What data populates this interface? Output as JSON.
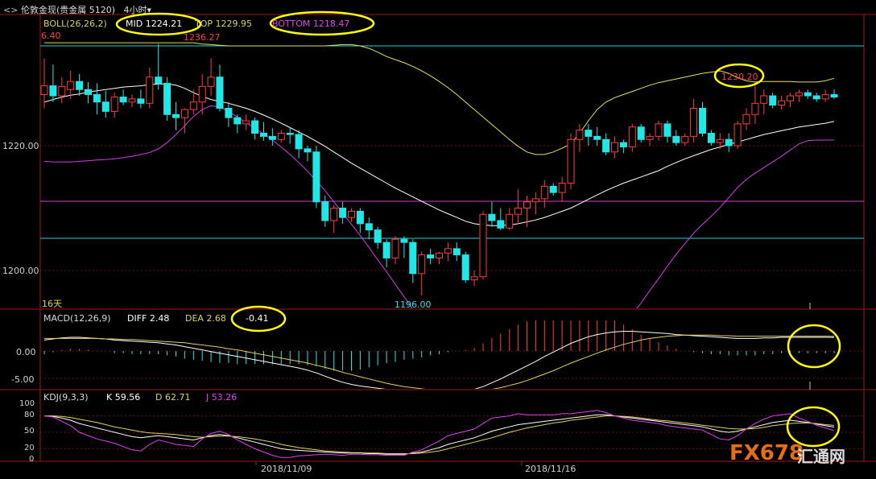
{
  "titlebar": {
    "icon": "back-arrows-icon",
    "symbol": "伦敦金现",
    "group": "(贵金属",
    "code": "5120)",
    "period": "4小时",
    "period_caret": "▼"
  },
  "boll": {
    "label": "BOLL(26,26,2)",
    "mid": "MID 1224.21",
    "top": "TOP 1229.95",
    "bottom": "BOTTOM 1218.47",
    "colors": {
      "mid": "#ffffff",
      "top": "#e8e05a",
      "bottom": "#d23be6"
    }
  },
  "price_axis": {
    "ticks": [
      "1220.00",
      "1200.00"
    ]
  },
  "price_labels": {
    "left_high": "6.40",
    "high": "1236.27",
    "recent_high": "1230.20",
    "low": "1196.00",
    "period_count": "16天"
  },
  "macd": {
    "label": "MACD(12,26,9)",
    "diff": "DIFF 2.48",
    "dea": "DEA 2.68",
    "macd_value": "-0.41",
    "axis": [
      "0.00",
      "-5.00"
    ]
  },
  "kdj": {
    "label": "KDJ(9,3,3)",
    "k": "K 59.56",
    "d": "D 62.71",
    "j": "J 53.26",
    "axis": [
      "100",
      "80",
      "50",
      "20",
      "0"
    ]
  },
  "dates": [
    "2018/11/09",
    "2018/11/16"
  ],
  "watermark": {
    "brand": "FX678",
    "cn": "汇通网"
  },
  "colors": {
    "up": "#ff3b3b",
    "down": "#22e6e6",
    "grid": "#8a1a1a",
    "highlight": "#ffff00"
  },
  "chart_data": [
    {
      "type": "candlestick",
      "title": "",
      "ohlc": [
        [
          1228.2,
          1234.0,
          1226.0,
          1229.6
        ],
        [
          1229.6,
          1233.0,
          1227.0,
          1228.0
        ],
        [
          1228.0,
          1231.0,
          1226.8,
          1229.5
        ],
        [
          1229.0,
          1232.0,
          1227.5,
          1230.3
        ],
        [
          1230.3,
          1231.5,
          1228.0,
          1229.0
        ],
        [
          1229.0,
          1230.2,
          1226.8,
          1228.2
        ],
        [
          1228.2,
          1230.0,
          1225.0,
          1227.0
        ],
        [
          1227.0,
          1228.8,
          1224.5,
          1225.5
        ],
        [
          1225.5,
          1228.5,
          1224.5,
          1227.8
        ],
        [
          1227.8,
          1229.0,
          1226.5,
          1227.0
        ],
        [
          1227.0,
          1228.2,
          1226.2,
          1227.5
        ],
        [
          1227.5,
          1229.0,
          1226.0,
          1226.8
        ],
        [
          1226.8,
          1232.5,
          1226.0,
          1231.0
        ],
        [
          1231.0,
          1236.3,
          1229.0,
          1230.0
        ],
        [
          1230.0,
          1231.0,
          1224.0,
          1225.0
        ],
        [
          1225.0,
          1227.0,
          1222.5,
          1224.5
        ],
        [
          1224.5,
          1226.0,
          1222.0,
          1225.8
        ],
        [
          1225.8,
          1229.0,
          1225.0,
          1227.0
        ],
        [
          1227.0,
          1231.5,
          1225.0,
          1229.5
        ],
        [
          1229.5,
          1234.0,
          1228.0,
          1231.0
        ],
        [
          1231.0,
          1233.0,
          1225.5,
          1226.0
        ],
        [
          1226.0,
          1227.0,
          1223.0,
          1224.5
        ],
        [
          1224.5,
          1225.0,
          1222.0,
          1223.5
        ],
        [
          1223.5,
          1225.0,
          1222.5,
          1224.0
        ],
        [
          1224.0,
          1224.5,
          1221.0,
          1222.0
        ],
        [
          1222.0,
          1223.8,
          1220.8,
          1221.5
        ],
        [
          1221.5,
          1222.8,
          1220.0,
          1221.0
        ],
        [
          1221.0,
          1222.5,
          1220.5,
          1222.0
        ],
        [
          1222.0,
          1223.0,
          1220.3,
          1221.8
        ],
        [
          1221.8,
          1222.5,
          1218.0,
          1219.5
        ],
        [
          1219.5,
          1220.0,
          1217.5,
          1219.0
        ],
        [
          1219.0,
          1220.0,
          1210.0,
          1211.0
        ],
        [
          1211.0,
          1212.0,
          1207.0,
          1208.0
        ],
        [
          1208.0,
          1210.5,
          1206.0,
          1210.0
        ],
        [
          1210.0,
          1211.0,
          1207.5,
          1208.5
        ],
        [
          1208.5,
          1210.0,
          1207.8,
          1209.5
        ],
        [
          1209.5,
          1210.0,
          1206.0,
          1207.5
        ],
        [
          1207.5,
          1208.5,
          1205.0,
          1206.5
        ],
        [
          1206.5,
          1207.0,
          1203.5,
          1204.5
        ],
        [
          1204.5,
          1205.0,
          1200.5,
          1202.0
        ],
        [
          1202.0,
          1205.5,
          1201.0,
          1205.0
        ],
        [
          1205.0,
          1205.5,
          1202.0,
          1204.5
        ],
        [
          1204.5,
          1205.0,
          1198.0,
          1199.5
        ],
        [
          1199.5,
          1203.0,
          1196.0,
          1202.5
        ],
        [
          1202.5,
          1203.5,
          1201.0,
          1202.0
        ],
        [
          1202.0,
          1203.0,
          1201.0,
          1202.8
        ],
        [
          1202.8,
          1204.5,
          1201.5,
          1203.5
        ],
        [
          1203.5,
          1204.5,
          1201.5,
          1202.5
        ],
        [
          1202.5,
          1203.0,
          1198.0,
          1198.5
        ],
        [
          1198.5,
          1200.0,
          1197.5,
          1199.0
        ],
        [
          1199.0,
          1209.5,
          1198.5,
          1209.0
        ],
        [
          1209.0,
          1211.0,
          1207.0,
          1208.0
        ],
        [
          1208.0,
          1210.0,
          1206.5,
          1206.8
        ],
        [
          1206.8,
          1210.0,
          1206.5,
          1209.0
        ],
        [
          1209.0,
          1213.0,
          1207.5,
          1210.0
        ],
        [
          1210.0,
          1212.0,
          1207.0,
          1211.0
        ],
        [
          1211.0,
          1212.5,
          1209.0,
          1211.5
        ],
        [
          1211.5,
          1214.5,
          1210.0,
          1213.5
        ],
        [
          1213.5,
          1214.0,
          1212.0,
          1212.5
        ],
        [
          1212.5,
          1215.0,
          1211.0,
          1214.0
        ],
        [
          1214.0,
          1222.0,
          1213.0,
          1221.0
        ],
        [
          1221.0,
          1223.5,
          1219.0,
          1222.5
        ],
        [
          1222.5,
          1223.5,
          1220.0,
          1221.5
        ],
        [
          1221.5,
          1223.0,
          1220.0,
          1221.0
        ],
        [
          1221.0,
          1222.0,
          1218.5,
          1219.0
        ],
        [
          1219.0,
          1221.5,
          1218.0,
          1220.5
        ],
        [
          1220.5,
          1221.0,
          1218.8,
          1219.8
        ],
        [
          1219.8,
          1223.5,
          1219.0,
          1223.0
        ],
        [
          1223.0,
          1223.5,
          1220.5,
          1221.0
        ],
        [
          1221.0,
          1222.0,
          1220.0,
          1221.5
        ],
        [
          1221.5,
          1224.0,
          1220.8,
          1223.5
        ],
        [
          1223.5,
          1224.0,
          1220.5,
          1221.5
        ],
        [
          1221.5,
          1222.5,
          1220.0,
          1220.5
        ],
        [
          1220.5,
          1222.0,
          1220.0,
          1221.5
        ],
        [
          1221.5,
          1227.5,
          1220.5,
          1226.0
        ],
        [
          1226.0,
          1227.0,
          1221.5,
          1222.0
        ],
        [
          1222.0,
          1222.5,
          1220.0,
          1220.5
        ],
        [
          1220.5,
          1222.0,
          1219.5,
          1221.0
        ],
        [
          1221.0,
          1222.0,
          1219.0,
          1220.0
        ],
        [
          1220.0,
          1224.0,
          1219.5,
          1223.5
        ],
        [
          1223.5,
          1226.0,
          1222.5,
          1225.0
        ],
        [
          1225.0,
          1230.2,
          1223.5,
          1226.8
        ],
        [
          1226.8,
          1229.0,
          1225.0,
          1228.0
        ],
        [
          1228.0,
          1228.5,
          1226.0,
          1226.5
        ],
        [
          1226.5,
          1228.0,
          1225.8,
          1227.2
        ],
        [
          1227.2,
          1228.5,
          1226.2,
          1228.0
        ],
        [
          1228.0,
          1229.0,
          1227.0,
          1228.5
        ],
        [
          1228.5,
          1229.0,
          1227.5,
          1228.0
        ],
        [
          1228.0,
          1228.5,
          1227.0,
          1227.5
        ],
        [
          1227.5,
          1229.0,
          1227.0,
          1228.2
        ],
        [
          1228.2,
          1229.0,
          1227.5,
          1227.8
        ]
      ],
      "boll_mid": [
        1227.0,
        1227.4,
        1227.8,
        1228.1,
        1228.3,
        1228.6,
        1228.8,
        1229.0,
        1229.2,
        1229.4,
        1229.5,
        1229.6,
        1229.8,
        1229.9,
        1229.9,
        1229.7,
        1229.2,
        1228.5,
        1227.9,
        1227.4,
        1227.1,
        1226.8,
        1226.4,
        1226.0,
        1225.5,
        1224.9,
        1224.3,
        1223.6,
        1222.9,
        1222.2,
        1221.5,
        1220.7,
        1219.9,
        1219.0,
        1218.1,
        1217.2,
        1216.4,
        1215.6,
        1214.8,
        1214.0,
        1213.2,
        1212.5,
        1211.8,
        1211.1,
        1210.4,
        1209.7,
        1209.1,
        1208.5,
        1207.9,
        1207.5,
        1207.3,
        1207.2,
        1207.2,
        1207.3,
        1207.5,
        1207.8,
        1208.1,
        1208.5,
        1209.0,
        1209.5,
        1210.0,
        1210.7,
        1211.4,
        1212.1,
        1212.8,
        1213.4,
        1214.0,
        1214.5,
        1215.0,
        1215.5,
        1216.0,
        1216.7,
        1217.3,
        1217.9,
        1218.4,
        1218.9,
        1219.4,
        1219.8,
        1220.2,
        1220.6,
        1221.0,
        1221.4,
        1221.8,
        1222.1,
        1222.4,
        1222.7,
        1223.0,
        1223.2,
        1223.4,
        1223.6,
        1223.9
      ],
      "boll_top": [
        1236.5,
        1236.5,
        1236.5,
        1236.5,
        1236.5,
        1236.5,
        1236.5,
        1236.5,
        1236.5,
        1236.5,
        1236.5,
        1236.5,
        1236.5,
        1236.5,
        1236.5,
        1236.5,
        1236.5,
        1236.5,
        1236.3,
        1236.2,
        1236.1,
        1236.0,
        1236.0,
        1236.0,
        1236.0,
        1236.0,
        1236.0,
        1236.0,
        1236.0,
        1236.0,
        1236.0,
        1236.0,
        1236.0,
        1236.1,
        1236.2,
        1236.2,
        1236.0,
        1235.6,
        1235.0,
        1234.3,
        1233.8,
        1233.3,
        1232.7,
        1232.0,
        1231.2,
        1230.3,
        1229.3,
        1228.2,
        1227.0,
        1225.8,
        1224.6,
        1223.4,
        1222.2,
        1221.0,
        1219.9,
        1219.0,
        1218.6,
        1218.6,
        1219.0,
        1219.6,
        1220.3,
        1222.0,
        1224.0,
        1225.8,
        1227.0,
        1227.7,
        1228.2,
        1228.7,
        1229.2,
        1229.7,
        1230.1,
        1230.4,
        1230.7,
        1231.0,
        1231.3,
        1231.6,
        1231.8,
        1232.0,
        1231.6,
        1230.9,
        1230.4,
        1230.2,
        1230.3,
        1230.3,
        1230.3,
        1230.3,
        1230.2,
        1230.2,
        1230.2,
        1230.4,
        1230.8
      ],
      "boll_bottom": [
        1217.5,
        1217.4,
        1217.4,
        1217.4,
        1217.5,
        1217.6,
        1217.7,
        1217.8,
        1217.9,
        1218.1,
        1218.3,
        1218.6,
        1218.9,
        1219.5,
        1220.5,
        1221.8,
        1223.2,
        1224.7,
        1225.8,
        1226.4,
        1226.2,
        1225.5,
        1224.6,
        1223.7,
        1222.8,
        1221.9,
        1220.9,
        1219.8,
        1218.6,
        1217.3,
        1215.9,
        1214.4,
        1212.8,
        1211.0,
        1209.2,
        1207.4,
        1205.6,
        1203.7,
        1201.7,
        1199.8,
        1197.8,
        1195.8,
        1193.8,
        1191.8,
        1189.9,
        1188.2,
        1187.0,
        1186.3,
        1186.2,
        1186.8,
        1187.7,
        1188.4,
        1188.7,
        1188.6,
        1188.3,
        1187.9,
        1187.6,
        1187.5,
        1187.6,
        1187.9,
        1188.4,
        1188.8,
        1189.0,
        1189.3,
        1189.6,
        1190.3,
        1191.5,
        1193.0,
        1194.8,
        1196.8,
        1198.7,
        1200.7,
        1202.6,
        1204.3,
        1206.0,
        1207.4,
        1208.7,
        1210.1,
        1211.7,
        1213.3,
        1214.6,
        1215.6,
        1216.5,
        1217.4,
        1218.3,
        1219.3,
        1220.3,
        1220.8,
        1220.9,
        1220.9,
        1220.9
      ],
      "macd_diff": [
        2.0,
        2.2,
        2.4,
        2.5,
        2.5,
        2.4,
        2.3,
        2.2,
        2.0,
        1.9,
        1.8,
        1.7,
        1.6,
        1.5,
        1.3,
        1.1,
        0.8,
        0.5,
        0.2,
        -0.1,
        -0.4,
        -0.7,
        -1.0,
        -1.3,
        -1.6,
        -1.9,
        -2.2,
        -2.5,
        -2.8,
        -3.1,
        -3.5,
        -4.0,
        -4.6,
        -5.2,
        -5.7,
        -6.1,
        -6.4,
        -6.6,
        -6.8,
        -7.0,
        -7.2,
        -7.3,
        -7.4,
        -7.5,
        -7.5,
        -7.5,
        -7.4,
        -7.3,
        -7.2,
        -7.0,
        -6.5,
        -5.8,
        -5.1,
        -4.3,
        -3.5,
        -2.7,
        -1.9,
        -1.0,
        -0.2,
        0.6,
        1.4,
        2.0,
        2.6,
        3.0,
        3.3,
        3.5,
        3.6,
        3.6,
        3.5,
        3.4,
        3.3,
        3.2,
        3.0,
        2.9,
        2.8,
        2.7,
        2.6,
        2.5,
        2.4,
        2.3,
        2.3,
        2.3,
        2.4,
        2.4,
        2.5,
        2.5,
        2.5,
        2.5,
        2.5,
        2.5,
        2.48
      ],
      "macd_dea": [
        2.3,
        2.3,
        2.3,
        2.3,
        2.3,
        2.3,
        2.3,
        2.2,
        2.2,
        2.1,
        2.1,
        2.0,
        1.9,
        1.8,
        1.7,
        1.6,
        1.5,
        1.3,
        1.1,
        0.9,
        0.7,
        0.4,
        0.2,
        -0.1,
        -0.4,
        -0.7,
        -1.0,
        -1.3,
        -1.6,
        -1.9,
        -2.2,
        -2.6,
        -3.0,
        -3.4,
        -3.9,
        -4.3,
        -4.7,
        -5.1,
        -5.5,
        -5.9,
        -6.2,
        -6.5,
        -6.7,
        -6.9,
        -7.1,
        -7.2,
        -7.3,
        -7.3,
        -7.3,
        -7.3,
        -7.2,
        -7.0,
        -6.7,
        -6.3,
        -5.9,
        -5.4,
        -4.8,
        -4.2,
        -3.6,
        -2.9,
        -2.2,
        -1.6,
        -1.0,
        -0.4,
        0.2,
        0.7,
        1.2,
        1.6,
        2.0,
        2.3,
        2.5,
        2.7,
        2.8,
        2.9,
        2.9,
        2.9,
        2.9,
        2.8,
        2.8,
        2.7,
        2.7,
        2.7,
        2.7,
        2.7,
        2.7,
        2.7,
        2.7,
        2.7,
        2.7,
        2.7,
        2.68
      ],
      "kdj_k": [
        80,
        79,
        76,
        72,
        66,
        62,
        58,
        54,
        50,
        46,
        42,
        40,
        42,
        44,
        42,
        40,
        38,
        36,
        40,
        44,
        46,
        44,
        40,
        36,
        32,
        28,
        24,
        20,
        18,
        17,
        16,
        15,
        14,
        13,
        12,
        12,
        12,
        11,
        11,
        10,
        10,
        10,
        12,
        14,
        18,
        22,
        28,
        32,
        36,
        40,
        46,
        52,
        56,
        60,
        64,
        66,
        68,
        70,
        72,
        74,
        76,
        78,
        80,
        82,
        82,
        80,
        78,
        76,
        74,
        72,
        70,
        68,
        66,
        64,
        62,
        60,
        56,
        52,
        50,
        52,
        56,
        60,
        64,
        68,
        70,
        72,
        70,
        68,
        65,
        62,
        59.56
      ],
      "kdj_d": [
        80,
        80,
        79,
        77,
        74,
        71,
        68,
        64,
        60,
        57,
        54,
        51,
        49,
        48,
        47,
        46,
        44,
        42,
        41,
        42,
        43,
        43,
        42,
        40,
        38,
        35,
        32,
        28,
        25,
        22,
        20,
        18,
        16,
        15,
        14,
        13,
        13,
        12,
        12,
        11,
        11,
        11,
        11,
        12,
        14,
        16,
        20,
        24,
        28,
        32,
        36,
        40,
        45,
        50,
        54,
        58,
        61,
        64,
        67,
        69,
        72,
        74,
        76,
        78,
        80,
        80,
        79,
        78,
        76,
        74,
        72,
        71,
        69,
        67,
        65,
        63,
        61,
        59,
        57,
        56,
        56,
        57,
        59,
        62,
        64,
        66,
        67,
        67,
        66,
        64,
        62.71
      ],
      "kdj_j": [
        80,
        78,
        70,
        62,
        50,
        44,
        38,
        34,
        30,
        24,
        18,
        16,
        28,
        36,
        32,
        28,
        26,
        24,
        38,
        48,
        52,
        46,
        36,
        28,
        20,
        14,
        8,
        4,
        4,
        7,
        8,
        9,
        10,
        9,
        8,
        10,
        10,
        9,
        9,
        8,
        8,
        8,
        14,
        18,
        26,
        34,
        44,
        48,
        52,
        56,
        66,
        76,
        78,
        80,
        84,
        82,
        82,
        82,
        82,
        84,
        84,
        86,
        88,
        90,
        86,
        80,
        76,
        72,
        70,
        68,
        66,
        62,
        60,
        58,
        56,
        54,
        46,
        38,
        36,
        44,
        56,
        66,
        74,
        80,
        82,
        84,
        76,
        70,
        63,
        58,
        53.26
      ]
    }
  ]
}
